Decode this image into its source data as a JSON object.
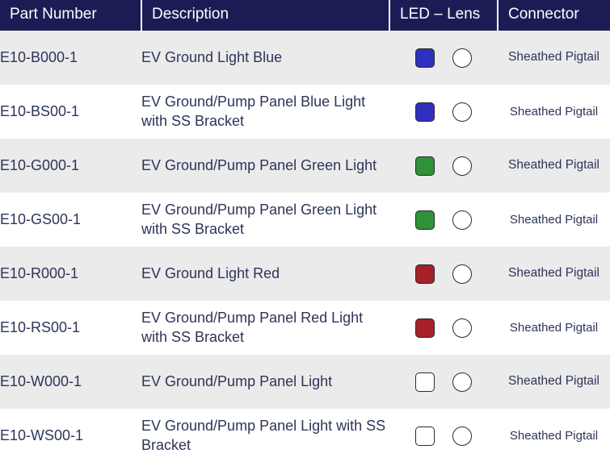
{
  "table": {
    "columns": [
      {
        "key": "part_number",
        "label": "Part Number"
      },
      {
        "key": "description",
        "label": "Description"
      },
      {
        "key": "led_lens",
        "label": "LED – Lens"
      },
      {
        "key": "connector",
        "label": "Connector"
      }
    ],
    "header_background": "#1c1c55",
    "header_text_color": "#ffffff",
    "row_alt_background": "#ebebeb",
    "row_background": "#ffffff",
    "body_text_color": "#2d3559",
    "led_colors": {
      "blue": "#3030bf",
      "green": "#2f9237",
      "red": "#a72028",
      "white": "#ffffff"
    },
    "lens_color": "#ffffff",
    "rows": [
      {
        "part_number": "E10-B000-1",
        "description": "EV Ground Light Blue",
        "led_color_name": "blue",
        "led_color": "#3030bf",
        "lens_icon": "lens-circle-icon",
        "connector": "Sheathed Pigtail",
        "striped": true
      },
      {
        "part_number": "E10-BS00-1",
        "description": "EV Ground/Pump Panel Blue Light with SS Bracket",
        "led_color_name": "blue",
        "led_color": "#3030bf",
        "lens_icon": "lens-circle-icon",
        "connector": "Sheathed Pigtail",
        "striped": false
      },
      {
        "part_number": "E10-G000-1",
        "description": "EV Ground/Pump Panel Green Light",
        "led_color_name": "green",
        "led_color": "#2f9237",
        "lens_icon": "lens-circle-icon",
        "connector": "Sheathed Pigtail",
        "striped": true
      },
      {
        "part_number": "E10-GS00-1",
        "description": "EV Ground/Pump Panel Green Light with SS Bracket",
        "led_color_name": "green",
        "led_color": "#2f9237",
        "lens_icon": "lens-circle-icon",
        "connector": "Sheathed Pigtail",
        "striped": false
      },
      {
        "part_number": "E10-R000-1",
        "description": "EV Ground Light Red",
        "led_color_name": "red",
        "led_color": "#a72028",
        "lens_icon": "lens-circle-icon",
        "connector": "Sheathed Pigtail",
        "striped": true
      },
      {
        "part_number": "E10-RS00-1",
        "description": "EV Ground/Pump Panel Red Light with SS Bracket",
        "led_color_name": "red",
        "led_color": "#a72028",
        "lens_icon": "lens-circle-icon",
        "connector": "Sheathed Pigtail",
        "striped": false
      },
      {
        "part_number": "E10-W000-1",
        "description": "EV Ground/Pump Panel Light",
        "led_color_name": "white",
        "led_color": "#ffffff",
        "lens_icon": "lens-circle-icon",
        "connector": "Sheathed Pigtail",
        "striped": true
      },
      {
        "part_number": "E10-WS00-1",
        "description": "EV Ground/Pump Panel Light with SS Bracket",
        "led_color_name": "white",
        "led_color": "#ffffff",
        "lens_icon": "lens-circle-icon",
        "connector": "Sheathed Pigtail",
        "striped": false
      }
    ]
  }
}
